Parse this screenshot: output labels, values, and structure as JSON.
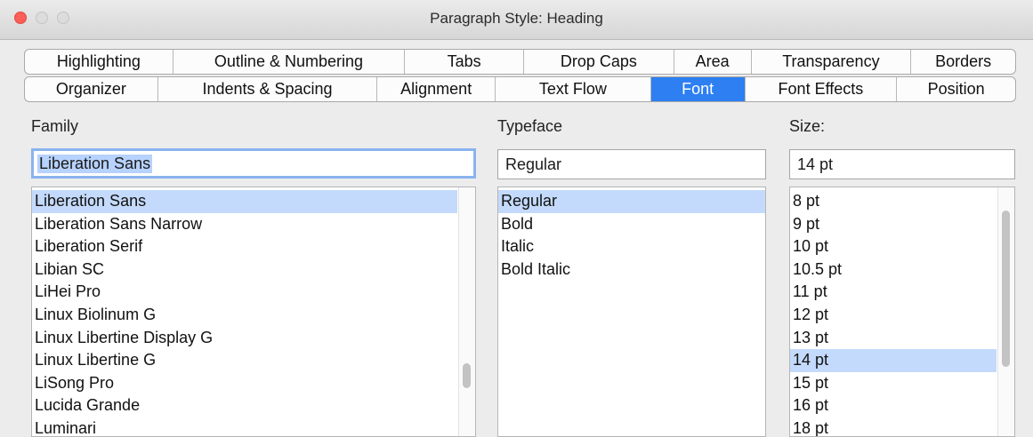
{
  "window": {
    "title": "Paragraph Style: Heading"
  },
  "tabs": {
    "row1": [
      "Highlighting",
      "Outline & Numbering",
      "Tabs",
      "Drop Caps",
      "Area",
      "Transparency",
      "Borders"
    ],
    "row2": [
      "Organizer",
      "Indents & Spacing",
      "Alignment",
      "Text Flow",
      "Font",
      "Font Effects",
      "Position"
    ],
    "active": "Font"
  },
  "family": {
    "label": "Family",
    "value": "Liberation Sans",
    "options": [
      "Liberation Sans",
      "Liberation Sans Narrow",
      "Liberation Serif",
      "Libian SC",
      "LiHei Pro",
      "Linux Biolinum G",
      "Linux Libertine Display G",
      "Linux Libertine G",
      "LiSong Pro",
      "Lucida Grande",
      "Luminari"
    ],
    "selected": "Liberation Sans"
  },
  "typeface": {
    "label": "Typeface",
    "value": "Regular",
    "options": [
      "Regular",
      "Bold",
      "Italic",
      "Bold Italic"
    ],
    "selected": "Regular"
  },
  "size": {
    "label": "Size:",
    "value": "14 pt",
    "options": [
      "8 pt",
      "9 pt",
      "10 pt",
      "10.5 pt",
      "11 pt",
      "12 pt",
      "13 pt",
      "14 pt",
      "15 pt",
      "16 pt",
      "18 pt"
    ],
    "selected": "14 pt"
  },
  "colors": {
    "accent": "#2d7ff2",
    "selection": "#c4dafc"
  }
}
